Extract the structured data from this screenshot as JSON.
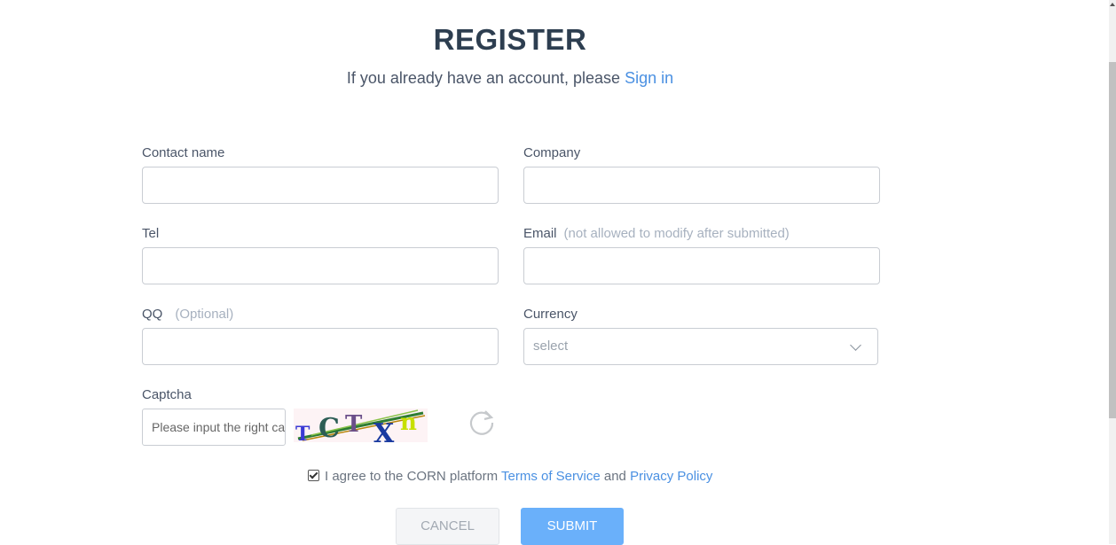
{
  "header": {
    "title": "REGISTER",
    "subtitle_prefix": "If you already have an account, please ",
    "signin_link": "Sign in"
  },
  "form": {
    "contact_name": {
      "label": "Contact name",
      "value": ""
    },
    "company": {
      "label": "Company",
      "value": ""
    },
    "tel": {
      "label": "Tel",
      "value": ""
    },
    "email": {
      "label": "Email",
      "hint": "(not allowed to modify after submitted)",
      "value": ""
    },
    "qq": {
      "label": "QQ",
      "hint": "(Optional)",
      "value": ""
    },
    "currency": {
      "label": "Currency",
      "selected": "select"
    },
    "captcha": {
      "label": "Captcha",
      "placeholder": "Please input the right captcha",
      "image_text": "TCTXn"
    }
  },
  "agreement": {
    "checked": true,
    "text": "I agree to the CORN platform ",
    "terms_link": "Terms of Service",
    "and": " and ",
    "privacy_link": "Privacy Policy"
  },
  "buttons": {
    "cancel": "CANCEL",
    "submit": "SUBMIT"
  },
  "colors": {
    "accent": "#4a90e2",
    "submit_bg": "#6ab0fa",
    "title": "#2d3e50"
  },
  "icons": [
    "chevron-down-icon",
    "refresh-icon",
    "checkbox-checked-icon"
  ]
}
